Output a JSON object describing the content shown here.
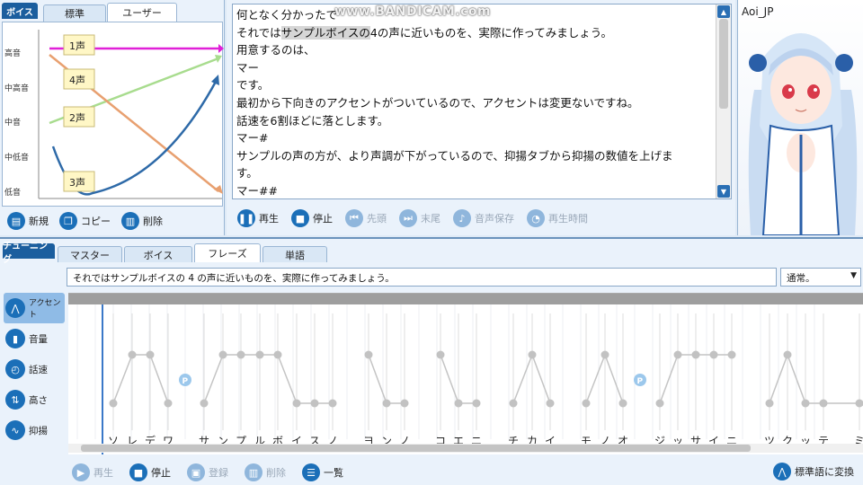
{
  "voice_panel": {
    "tab_label": "ボイス",
    "tabs": [
      {
        "label": "標準"
      },
      {
        "label": "ユーザー"
      }
    ],
    "pitch_levels": [
      "高音",
      "中高音",
      "中音",
      "中低音",
      "低音"
    ],
    "voice_labels": [
      "1声",
      "4声",
      "2声",
      "3声"
    ],
    "actions": [
      {
        "label": "新規"
      },
      {
        "label": "コピー"
      },
      {
        "label": "削除"
      }
    ],
    "colors": {
      "tone1": "#e020d8",
      "tone2": "#a8dc8e",
      "tone3": "#2e6aa8",
      "tone4": "#e8a070"
    }
  },
  "text_panel": {
    "watermark": "www.BANDICAM.com",
    "lines": [
      {
        "pre": "何となく分かったで",
        "hl": "",
        "post": ""
      },
      {
        "pre": "それでは",
        "hl": "サンプルボイスの",
        "post": "4の声に近いものを、実際に作ってみましょう。"
      },
      {
        "pre": "用意するのは、",
        "hl": "",
        "post": ""
      },
      {
        "pre": "マー",
        "hl": "",
        "post": ""
      },
      {
        "pre": "です。",
        "hl": "",
        "post": ""
      },
      {
        "pre": "最初から下向きのアクセントがついているので、アクセントは変更ないですね。",
        "hl": "",
        "post": ""
      },
      {
        "pre": "話速を6割ほどに落とします。",
        "hl": "",
        "post": ""
      },
      {
        "pre": "マー#",
        "hl": "",
        "post": ""
      },
      {
        "pre": "サンプルの声の方が、より声調が下がっているので、抑揚タブから抑揚の数値を上げま",
        "hl": "",
        "post": ""
      },
      {
        "pre": "す。",
        "hl": "",
        "post": ""
      },
      {
        "pre": "マー##",
        "hl": "",
        "post": ""
      }
    ],
    "player": [
      {
        "label": "再生",
        "icon": "pause-icon",
        "enabled": true
      },
      {
        "label": "停止",
        "icon": "stop-icon",
        "enabled": true
      },
      {
        "label": "先頭",
        "icon": "skip-back-icon",
        "enabled": false
      },
      {
        "label": "末尾",
        "icon": "skip-forward-icon",
        "enabled": false
      },
      {
        "label": "音声保存",
        "icon": "wav-icon",
        "enabled": false
      },
      {
        "label": "再生時間",
        "icon": "clock-icon",
        "enabled": false
      }
    ]
  },
  "avatar": {
    "name": "Aoi_JP"
  },
  "tuning": {
    "label": "チューニング",
    "tabs": [
      {
        "label": "マスター"
      },
      {
        "label": "ボイス"
      },
      {
        "label": "フレーズ"
      },
      {
        "label": "単語"
      }
    ],
    "active_tab": "フレーズ",
    "phrase_text": "それではサンプルボイスの 4 の声に近いものを、実際に作ってみましょう。",
    "mode": "通常。",
    "side_tools": [
      {
        "label": "アクセント",
        "icon": "accent-icon"
      },
      {
        "label": "音量",
        "icon": "volume-icon"
      },
      {
        "label": "話速",
        "icon": "speed-icon"
      },
      {
        "label": "高さ",
        "icon": "pitch-icon"
      },
      {
        "label": "抑揚",
        "icon": "intonation-icon"
      }
    ],
    "moras": [
      "ソ",
      "レ",
      "デ",
      "ワ",
      "サ",
      "ン",
      "プ",
      "ル",
      "ボ",
      "イ",
      "ス",
      "ノ",
      "ヨ",
      "ン",
      "ノ",
      "コ",
      "エ",
      "ニ",
      "チ",
      "カ",
      "イ",
      "モ",
      "ノ",
      "オ",
      "ジ",
      "ッ",
      "サ",
      "イ",
      "ニ",
      "ツ",
      "ク",
      "ッ",
      "テ",
      "ミ"
    ],
    "pause_marker": "P",
    "actions": [
      {
        "label": "再生",
        "icon": "play-icon",
        "enabled": false
      },
      {
        "label": "停止",
        "icon": "stop-icon",
        "enabled": true
      },
      {
        "label": "登録",
        "icon": "save-icon",
        "enabled": false
      },
      {
        "label": "削除",
        "icon": "trash-icon",
        "enabled": false
      },
      {
        "label": "一覧",
        "icon": "list-icon",
        "enabled": true
      }
    ],
    "convert_label": "標準語に変換"
  }
}
